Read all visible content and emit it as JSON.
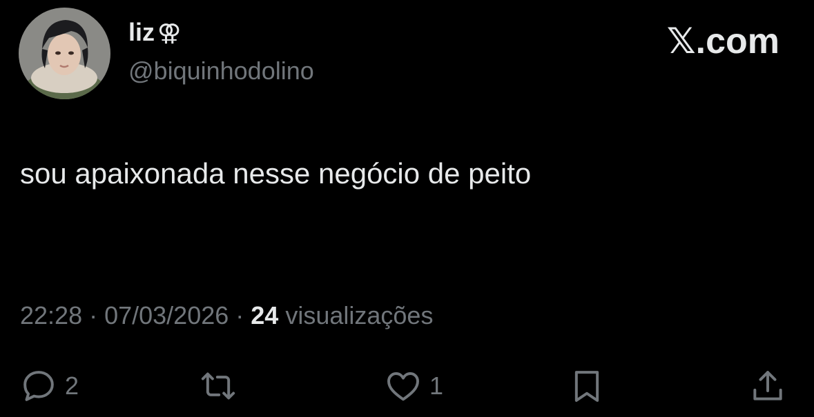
{
  "header": {
    "display_name": "liz",
    "name_symbol": "⚢",
    "handle": "@biquinhodolino",
    "brand": "𝕏.com"
  },
  "tweet": {
    "text": "sou apaixonada nesse negócio de peito"
  },
  "meta": {
    "time": "22:28",
    "sep1": " · ",
    "date": "07/03/2026",
    "sep2": " · ",
    "views_count": "24",
    "views_label": "visualizações"
  },
  "actions": {
    "reply_count": "2",
    "like_count": "1"
  },
  "icons": {
    "reply": "reply-icon",
    "retweet": "retweet-icon",
    "like": "heart-icon",
    "bookmark": "bookmark-icon",
    "share": "share-icon"
  },
  "colors": {
    "background": "#000000",
    "primary_text": "#e7e9ea",
    "secondary_text": "#71767b"
  }
}
